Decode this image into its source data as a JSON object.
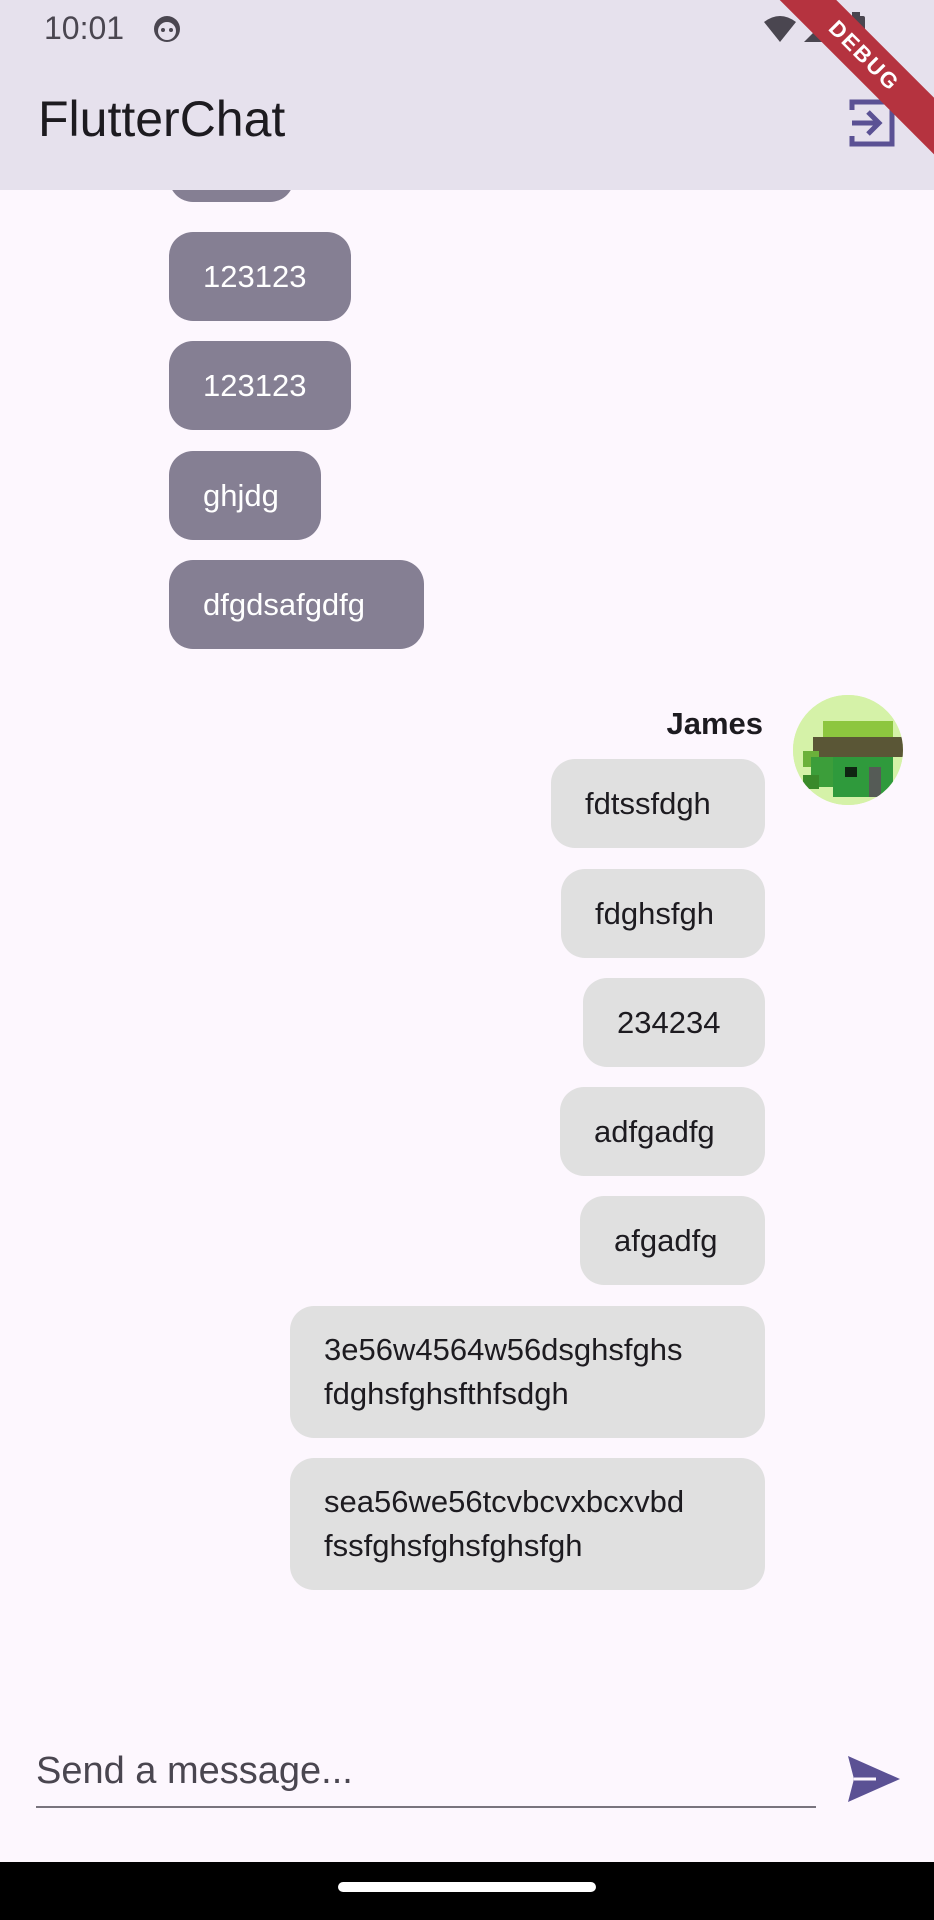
{
  "status_bar": {
    "time": "10:01",
    "icons": [
      "face-icon",
      "wifi-icon",
      "signal-icon",
      "battery-icon"
    ]
  },
  "app_bar": {
    "title": "FlutterChat",
    "logout_icon": "logout-icon",
    "debug_label": "DEBUG"
  },
  "chat": {
    "other_messages": [
      "123123",
      "123123",
      "ghjdg",
      "dfgdsafgdfg"
    ],
    "sender": {
      "name": "James",
      "messages": [
        "fdtssfdgh",
        "fdghsfgh",
        "234234",
        "adfgadfg",
        "afgadfg",
        "3e56w4564w56dsghsfghs\nfdghsfghsfthfsdgh",
        "sea56we56tcvbcvxbcxvbd\nfssfghsfghsfghsfgh"
      ]
    }
  },
  "composer": {
    "placeholder": "Send a message...",
    "send_icon": "send-icon"
  },
  "colors": {
    "accent": "#5b5194",
    "other_bubble": "#857f93",
    "mine_bubble": "#e0e0e0",
    "app_bar": "#e6e1ed"
  }
}
